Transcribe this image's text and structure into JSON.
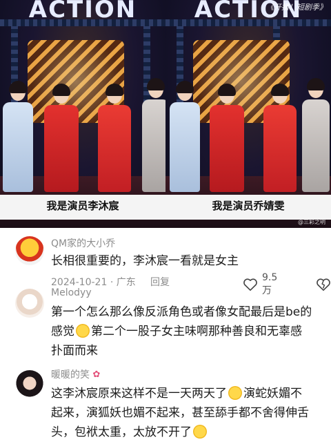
{
  "video": {
    "stage_word": "ACTION",
    "watermark_top": "《开播！短剧季》",
    "watermark_bottom": "@三彩之明",
    "subtitle_left": "我是演员李沐宸",
    "subtitle_right": "我是演员乔婧雯"
  },
  "comments": [
    {
      "username": "QM家的大小乔",
      "text": "长相很重要的，李沐宸一看就是女主",
      "date": "2024-10-21",
      "location": "广东",
      "reply_label": "回复",
      "like_count": "9.5万"
    },
    {
      "username": "Melodyy",
      "line1": "第一个怎么那么像反派角色或者像女配最后是be的",
      "line2a": "感觉",
      "line2b": "第二个一股子女主味啊那种善良和无辜感",
      "line3": "扑面而来"
    },
    {
      "username": "暖暖的笑",
      "line1a": "这李沐宸原来这样不是一天两天了",
      "line1b": "演蛇妖媚不",
      "line2": "起来，演狐妖也媚不起来，甚至舔手都不舍得伸舌",
      "line3": "头，包袱太重，太放不开了"
    }
  ],
  "icons": {
    "like": "heart-outline-icon",
    "dislike": "broken-heart-outline-icon",
    "emoji_laugh": "laughing-tears-emoji",
    "emoji_smile": "smirk-emoji",
    "username_decoration": "flower-icon"
  },
  "colors": {
    "secondary_text": "#8c8c8c",
    "body_text": "#1c1c1c"
  }
}
